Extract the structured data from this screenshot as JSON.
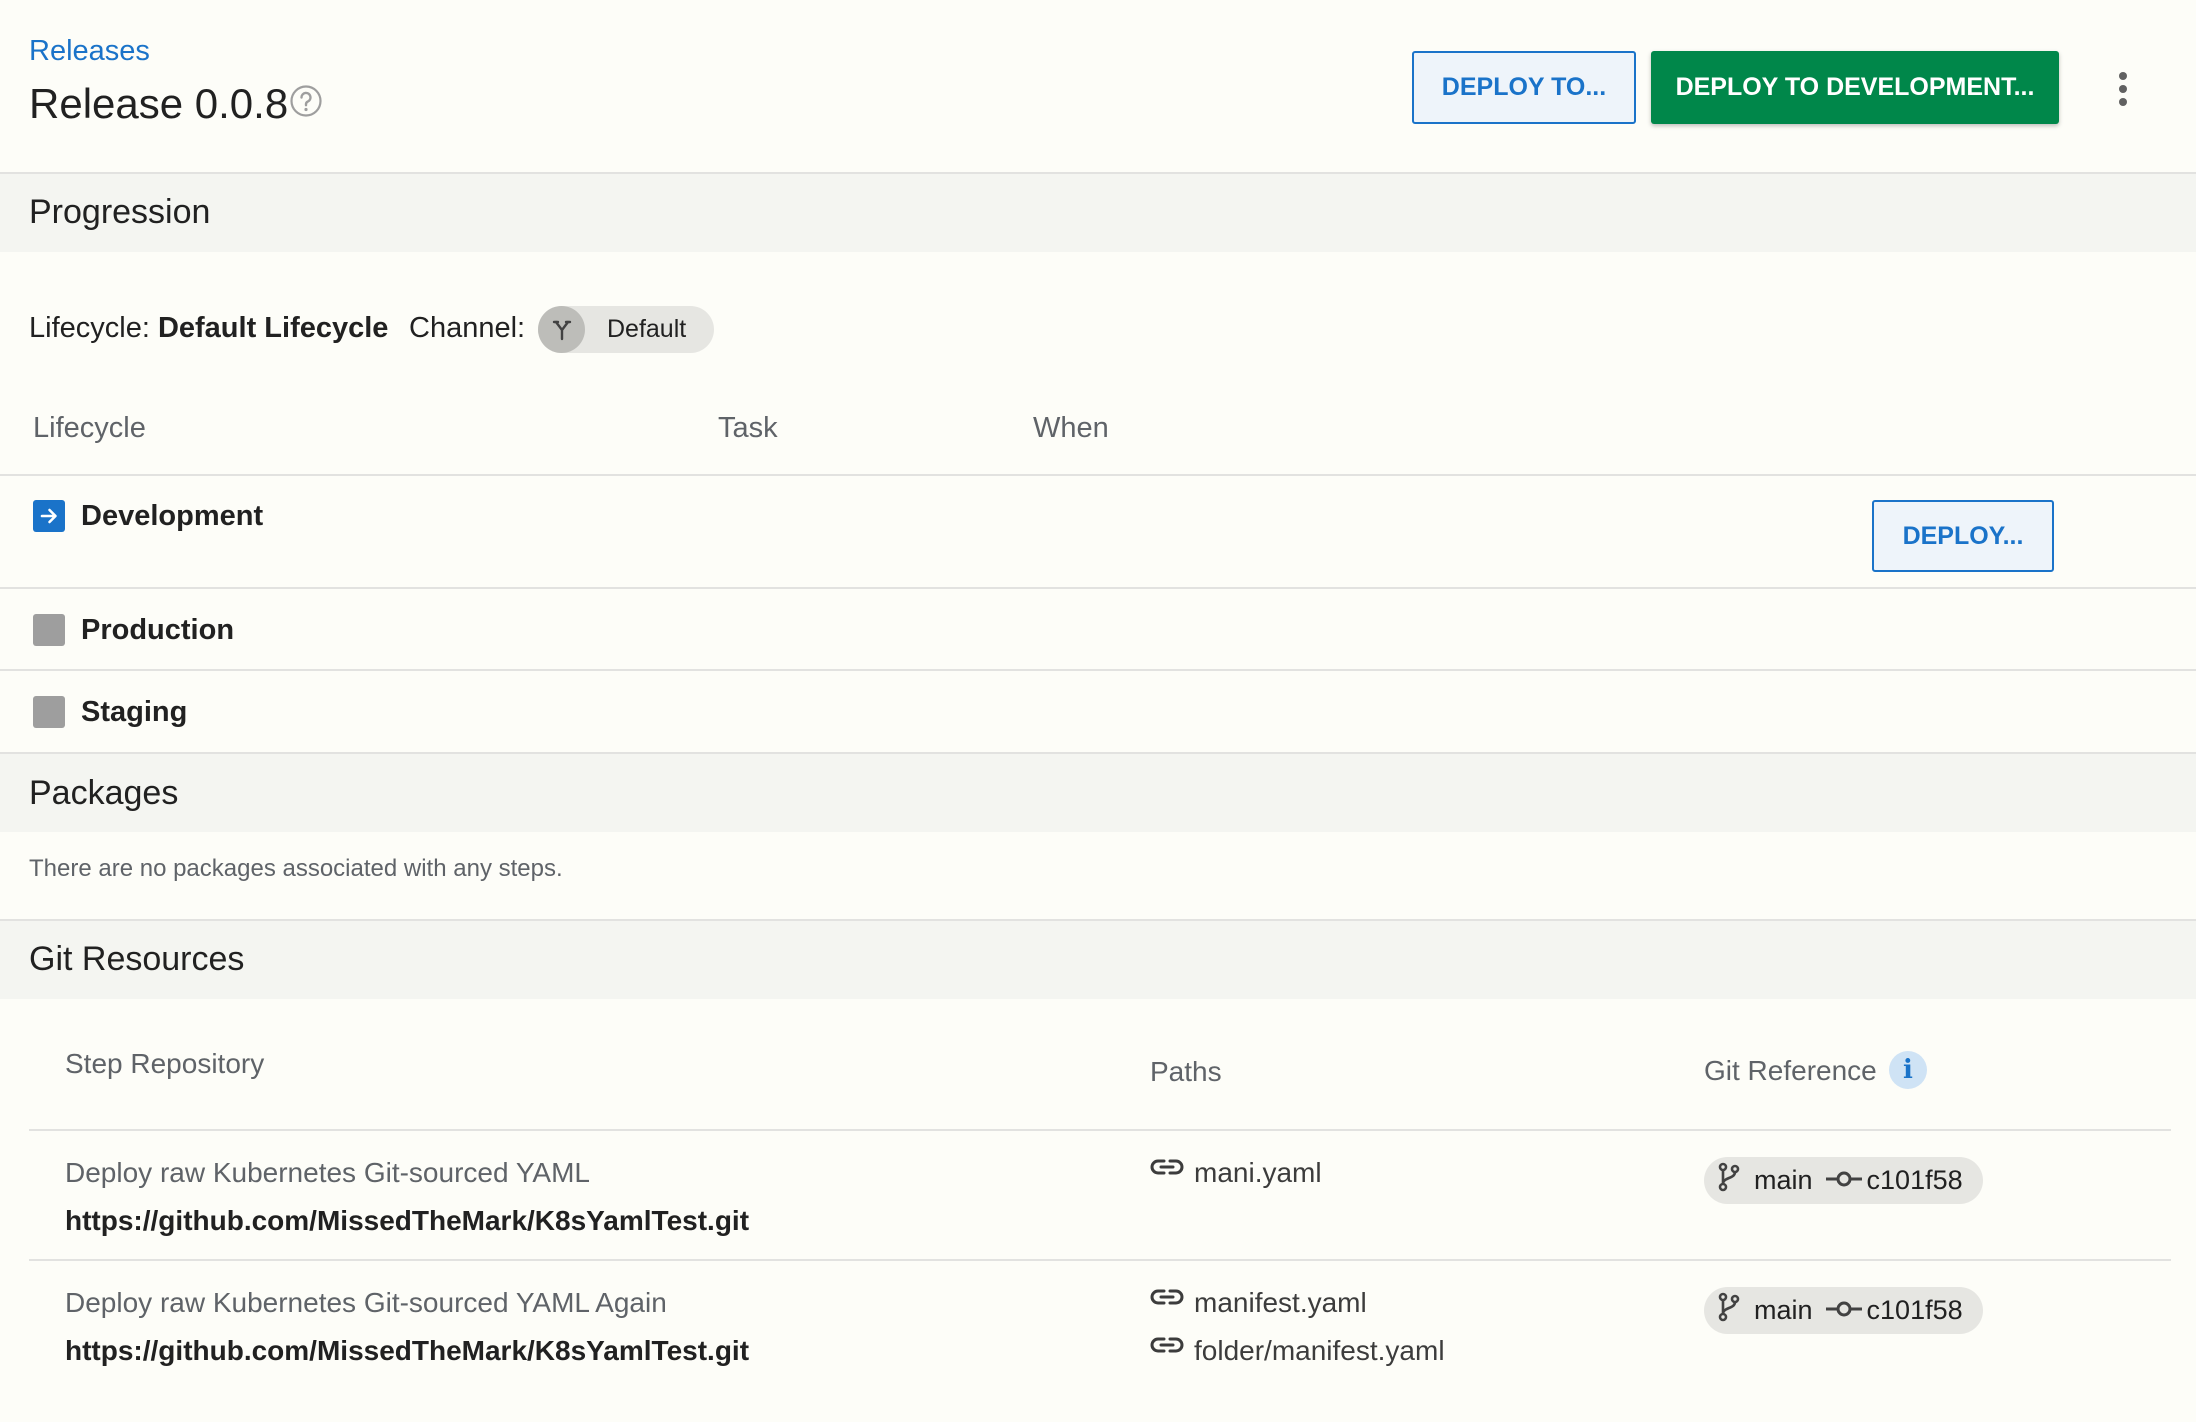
{
  "header": {
    "breadcrumb": "Releases",
    "title": "Release 0.0.8",
    "deploy_to_label": "DEPLOY TO...",
    "deploy_to_dev_label": "DEPLOY TO DEVELOPMENT..."
  },
  "progression": {
    "section_title": "Progression",
    "lifecycle_prefix": "Lifecycle:",
    "lifecycle_value": "Default Lifecycle",
    "channel_label": "Channel:",
    "channel_value": "Default",
    "columns": [
      "Lifecycle",
      "Task",
      "When"
    ],
    "phases": [
      {
        "name": "Development",
        "icon": "arrow-right-icon",
        "color": "#1a73c9",
        "deploy_label": "DEPLOY..."
      },
      {
        "name": "Production",
        "icon": "gray-square-icon",
        "color": "#9e9e9e"
      },
      {
        "name": "Staging",
        "icon": "gray-square-icon",
        "color": "#9e9e9e"
      }
    ]
  },
  "packages": {
    "section_title": "Packages",
    "empty_text": "There are no packages associated with any steps."
  },
  "git_resources": {
    "section_title": "Git Resources",
    "columns": {
      "step_repository": "Step Repository",
      "paths": "Paths",
      "git_reference": "Git Reference"
    },
    "rows": [
      {
        "step": "Deploy raw Kubernetes Git-sourced YAML",
        "repo": "https://github.com/MissedTheMark/K8sYamlTest.git",
        "paths": [
          "mani.yaml"
        ],
        "branch": "main",
        "commit": "c101f58"
      },
      {
        "step": "Deploy raw Kubernetes Git-sourced YAML Again",
        "repo": "https://github.com/MissedTheMark/K8sYamlTest.git",
        "paths": [
          "manifest.yaml",
          "folder/manifest.yaml"
        ],
        "branch": "main",
        "commit": "c101f58"
      }
    ]
  },
  "colors": {
    "accent_blue": "#1a73c9",
    "deploy_green": "#00874a",
    "background": "#fdfdf8",
    "section_header_bg": "#f4f5f1"
  }
}
